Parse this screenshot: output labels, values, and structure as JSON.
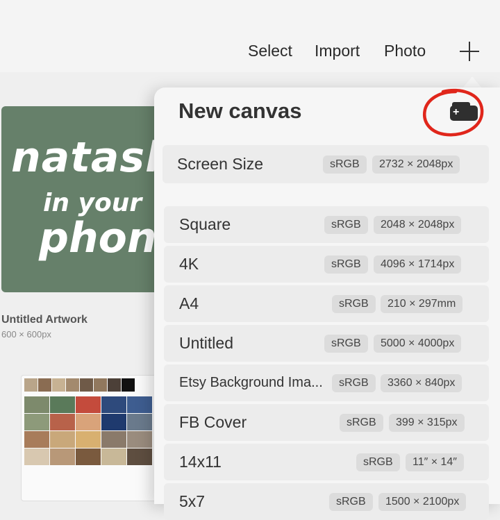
{
  "toolbar": {
    "select_label": "Select",
    "import_label": "Import",
    "photo_label": "Photo",
    "add_icon": "plus-icon"
  },
  "gallery": {
    "artwork": {
      "lines": [
        "natash",
        "in your",
        "phone"
      ],
      "title": "Untitled Artwork",
      "size": "600 × 600px",
      "background": "#66806a"
    }
  },
  "popover": {
    "title": "New canvas",
    "new_folder_icon": "new-folder-icon",
    "annotation_color": "#e0261b",
    "canvases": [
      {
        "name": "Screen Size",
        "profile": "sRGB",
        "dimensions": "2732 × 2048px"
      },
      {
        "name": "Square",
        "profile": "sRGB",
        "dimensions": "2048 × 2048px"
      },
      {
        "name": "4K",
        "profile": "sRGB",
        "dimensions": "4096 × 1714px"
      },
      {
        "name": "A4",
        "profile": "sRGB",
        "dimensions": "210 × 297mm"
      },
      {
        "name": "Untitled",
        "profile": "sRGB",
        "dimensions": "5000 × 4000px"
      },
      {
        "name": "Etsy Background Ima...",
        "profile": "sRGB",
        "dimensions": "3360 × 840px"
      },
      {
        "name": "FB Cover",
        "profile": "sRGB",
        "dimensions": "399 × 315px"
      },
      {
        "name": "14x11",
        "profile": "sRGB",
        "dimensions": "11″ × 14″"
      },
      {
        "name": "5x7",
        "profile": "sRGB",
        "dimensions": "1500 × 2100px"
      }
    ]
  }
}
